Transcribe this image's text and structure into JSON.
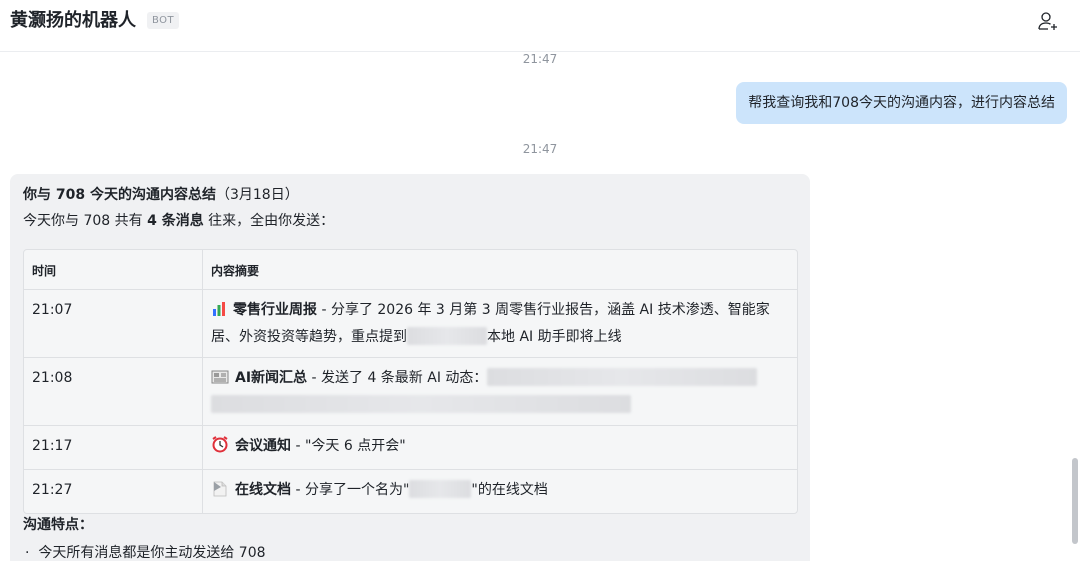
{
  "header": {
    "title": "黄灏扬的机器人",
    "badge": "BOT",
    "add_member_icon": "add-user-icon"
  },
  "messages": {
    "time1": "21:47",
    "user_text": "帮我查询我和708今天的沟通内容，进行内容总结",
    "time2": "21:47",
    "reply": {
      "title_bold": "你与 708 今天的沟通内容总结",
      "title_rest": "（3月18日）",
      "intro_pre": "今天你与 708 共有 ",
      "intro_bold": "4 条消息",
      "intro_post": " 往来，全由你发送：",
      "table": {
        "headers": [
          "时间",
          "内容摘要"
        ],
        "rows": [
          {
            "time": "21:07",
            "icon": "bar-chart-icon",
            "bold": "零售行业周报",
            "text": " - 分享了 2026 年 3 月第 3 周零售行业报告，涵盖 AI 技术渗透、智能家居、外资投资等趋势，重点提到",
            "text2": "本地 AI 助手即将上线"
          },
          {
            "time": "21:08",
            "icon": "newspaper-icon",
            "bold": "AI新闻汇总",
            "text": " - 发送了 4 条最新 AI 动态："
          },
          {
            "time": "21:17",
            "icon": "alarm-clock-icon",
            "bold": "会议通知",
            "text": " - \"今天 6 点开会\""
          },
          {
            "time": "21:27",
            "icon": "document-icon",
            "bold": "在线文档",
            "text": " - 分享了一个名为\"",
            "text2": "\"的在线文档"
          }
        ]
      },
      "features_title": "沟通特点：",
      "bullet1": "今天所有消息都是你主动发送给 708"
    }
  },
  "colors": {
    "user_bubble": "#cce4fb",
    "bot_bubble": "#f0f1f3",
    "table_bg": "#f5f6f7"
  }
}
